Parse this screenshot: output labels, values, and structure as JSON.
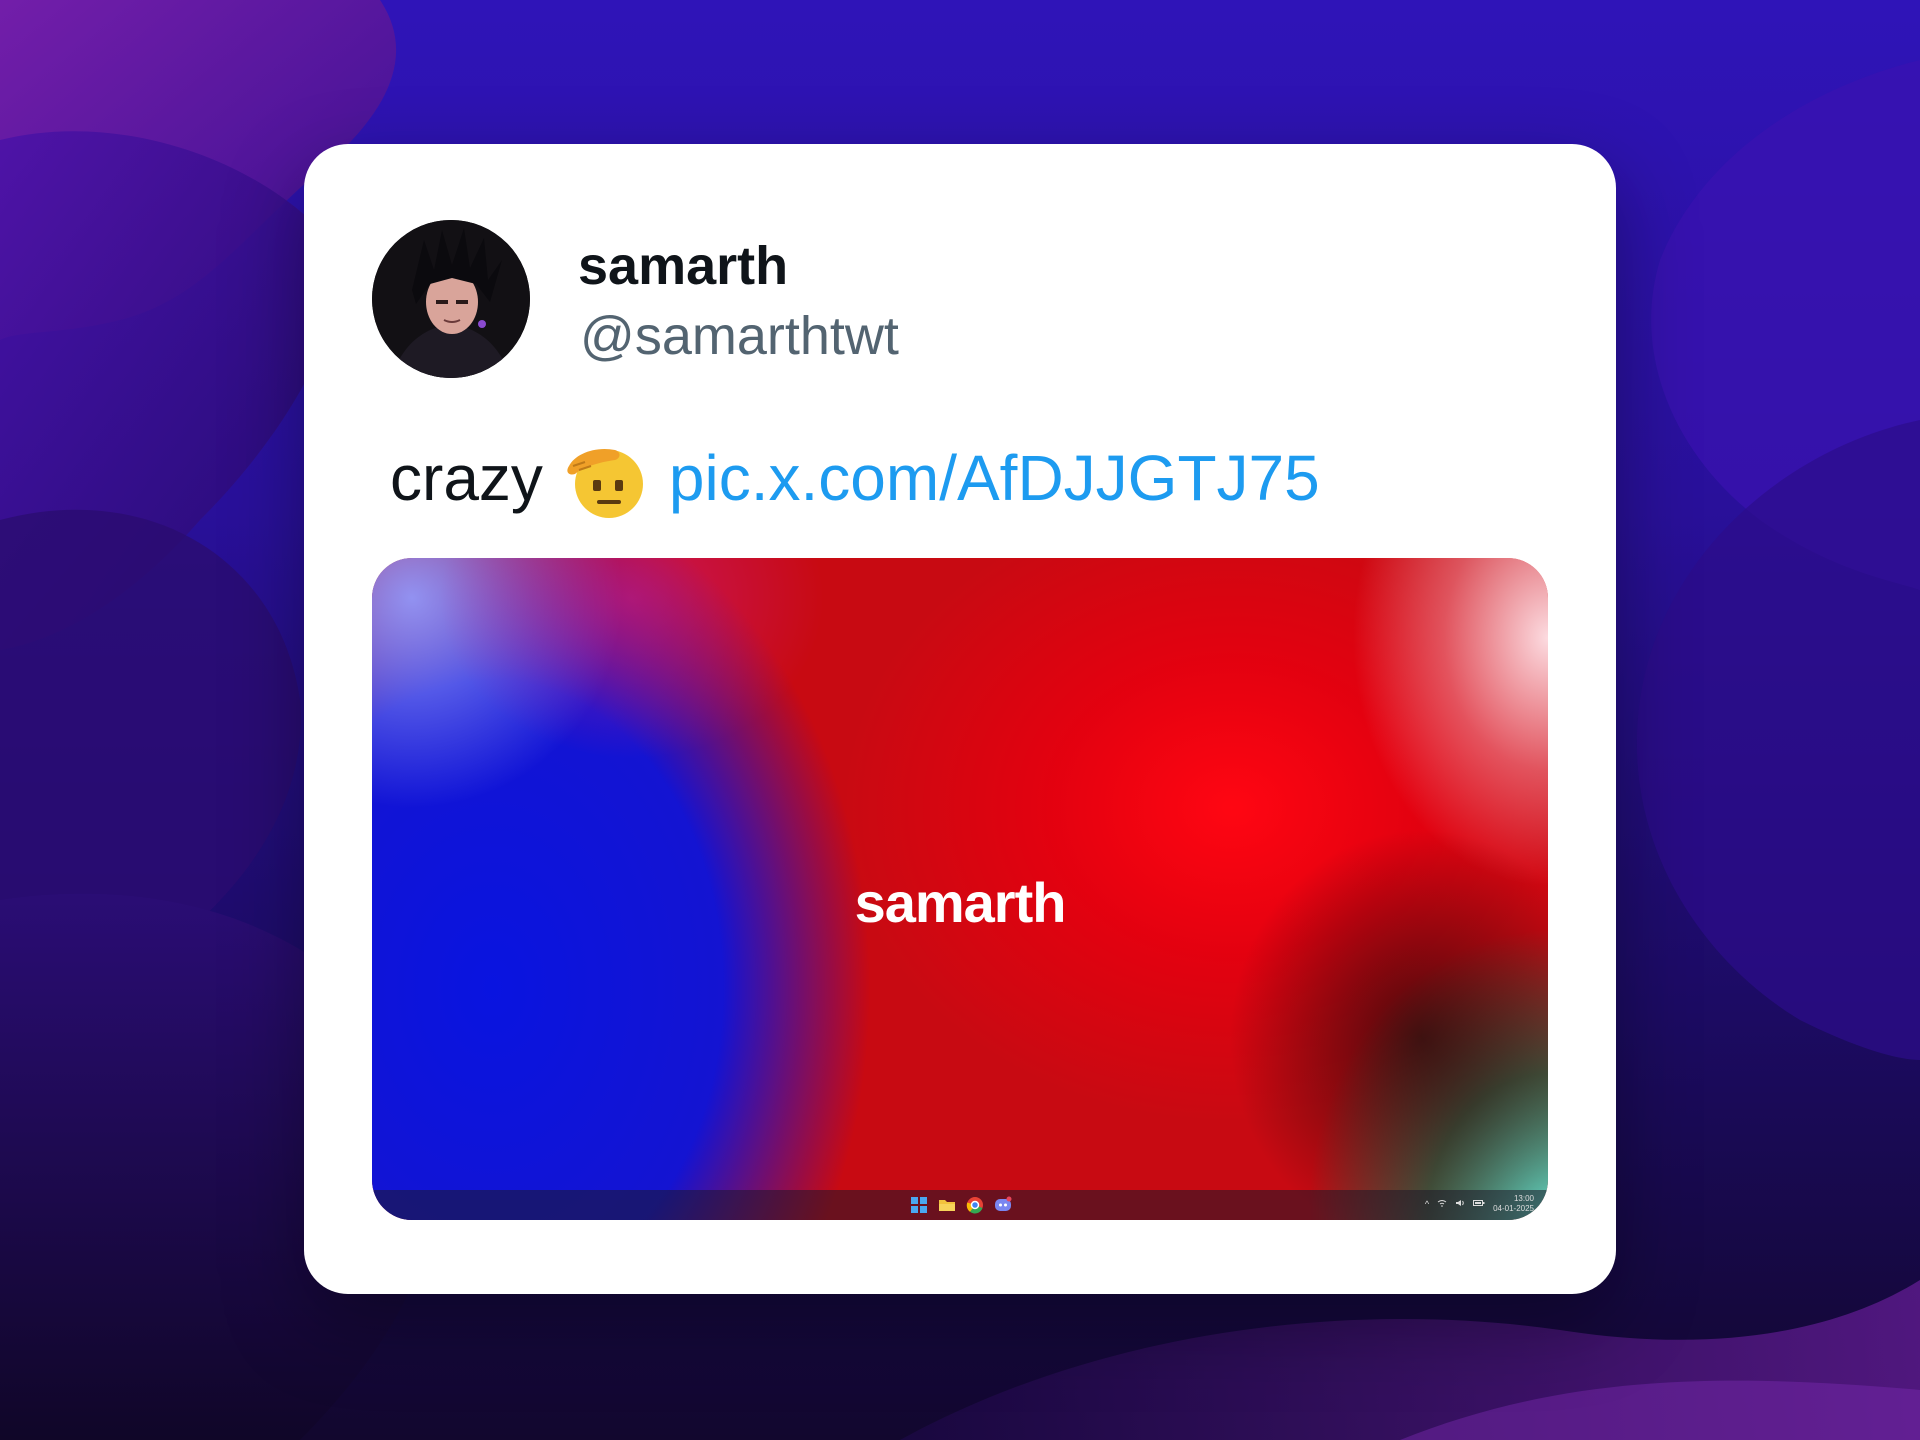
{
  "tweet": {
    "display_name": "samarth",
    "handle": "@samarthtwt",
    "text_word": "crazy",
    "emoji_icon": "saluting-face-emoji",
    "link": "pic.x.com/AfDJJGTJ75",
    "link_color": "#1d9bf0"
  },
  "media": {
    "title": "samarth",
    "taskbar": {
      "apps": [
        "windows-start-icon",
        "file-explorer-icon",
        "chrome-icon",
        "discord-icon"
      ],
      "tray_icons": [
        "chevron-up-icon",
        "wifi-icon",
        "volume-icon",
        "battery-icon"
      ],
      "time": "13:00",
      "date": "04-01-2025"
    }
  },
  "colors": {
    "card_background": "#ffffff",
    "name": "#0f1419",
    "handle": "#536471"
  }
}
